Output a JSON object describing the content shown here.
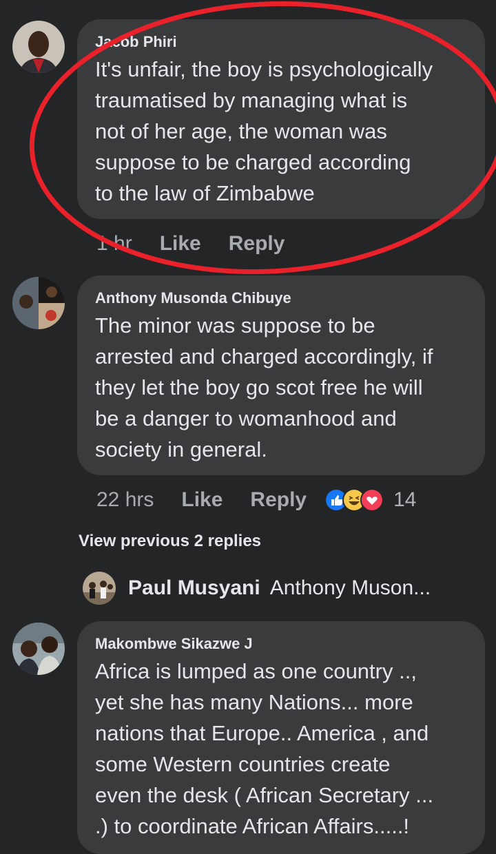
{
  "comments": [
    {
      "author": "Jacob Phiri",
      "text_lines": [
        "It's unfair, the boy is psychologically",
        "traumatised by managing what is",
        "not of her age, the woman was",
        "suppose to be charged according",
        "to the law of Zimbabwe"
      ],
      "time": "1 hr",
      "like_label": "Like",
      "reply_label": "Reply"
    },
    {
      "author": "Anthony Musonda Chibuye",
      "text_lines": [
        "The minor was suppose to be",
        "arrested and charged accordingly, if",
        "they let the boy go scot free he will",
        "be a danger to womanhood and",
        "society in general."
      ],
      "time": "22 hrs",
      "like_label": "Like",
      "reply_label": "Reply",
      "reaction_icons": [
        "like-reaction-icon",
        "haha-reaction-icon",
        "love-reaction-icon"
      ],
      "reaction_count": "14"
    },
    {
      "author": "Makombwe Sikazwe J",
      "text_lines": [
        "Africa is lumped as one country ..,",
        "yet she has many Nations... more",
        "nations that Europe.. America , and",
        "some Western countries create",
        "even the  desk ( African Secretary ...",
        ".) to coordinate African Affairs.....!"
      ]
    }
  ],
  "replies": {
    "view_previous_label": "View previous 2 replies",
    "latest": {
      "author": "Paul Musyani",
      "preview": "Anthony Muson..."
    }
  },
  "colors": {
    "background": "#242526",
    "bubble": "#3a3b3c",
    "annotation_circle": "#e8212b",
    "like_blue": "#1877f2",
    "haha_yellow": "#f7c94a",
    "love_red": "#f33e58"
  }
}
